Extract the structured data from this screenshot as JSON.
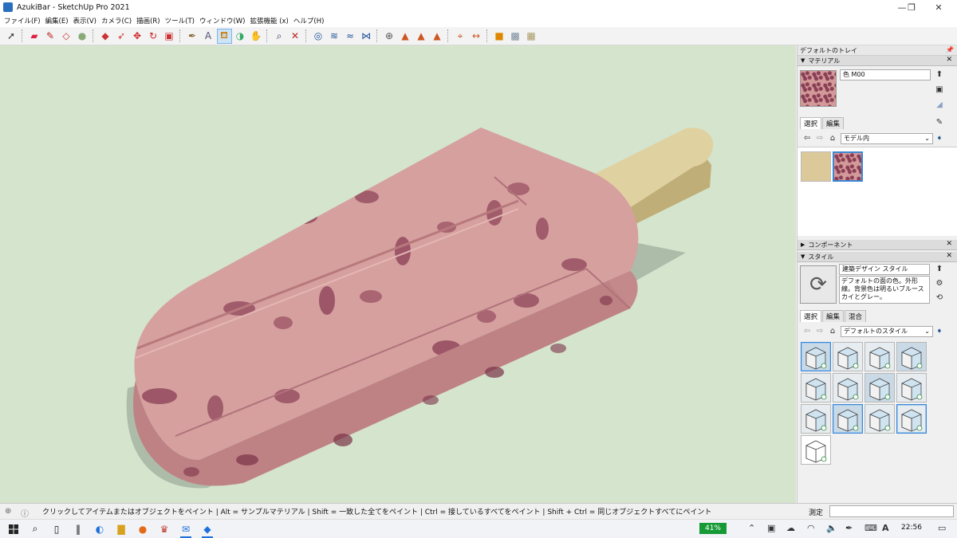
{
  "window": {
    "title": "AzukiBar - SketchUp Pro 2021",
    "minimize": "—",
    "maximize": "❐",
    "close": "✕"
  },
  "menu": [
    "ファイル(F)",
    "編集(E)",
    "表示(V)",
    "カメラ(C)",
    "描画(R)",
    "ツール(T)",
    "ウィンドウ(W)",
    "拡張機能 (x)",
    "ヘルプ(H)"
  ],
  "toolbar": {
    "tools": [
      "select-icon",
      "eraser-icon",
      "pencil-icon",
      "shape-icon",
      "circle-icon",
      "push-pull-icon",
      "follow-me-icon",
      "move-icon",
      "rotate-icon",
      "scale-icon",
      "tape-measure-icon",
      "text-icon",
      "paint-bucket-icon",
      "orbit-icon",
      "pan-icon",
      "zoom-icon",
      "zoom-extents-icon",
      "section-plane-icon",
      "section-fill-icon",
      "section-display-icon",
      "walk-icon",
      "geo-location-icon",
      "sandbox-icon",
      "sandbox-stamp-icon",
      "sandbox-drape-icon",
      "axes-icon",
      "dimension-icon",
      "warehouse-icon",
      "extension-warehouse-icon",
      "layout-icon"
    ],
    "active": "paint-bucket-icon"
  },
  "tray": {
    "title": "デフォルトのトレイ",
    "materials": {
      "header": "マテリアル",
      "material_name": "色 M00",
      "tabs": [
        "選択",
        "編集"
      ],
      "collection": "モデル内",
      "swatches": [
        {
          "name": "stick-material",
          "color": "#dcc99a"
        },
        {
          "name": "azuki-material",
          "color": "#d39a9a"
        }
      ]
    },
    "components": {
      "header": "コンポーネント"
    },
    "styles": {
      "header": "スタイル",
      "style_name": "建築デザイン スタイル",
      "description": "デフォルトの面の色。外形線。背景色は明るいブルースカイとグレー。",
      "tabs": [
        "選択",
        "編集",
        "混合"
      ],
      "collection": "デフォルトのスタイル",
      "thumb_count": 13
    }
  },
  "status": {
    "hint": "クリックしてアイテムまたはオブジェクトをペイント | Alt = サンプルマテリアル | Shift = 一致した全てをペイント | Ctrl = 接しているすべてをペイント | Shift + Ctrl = 同じオブジェクトすべてにペイント",
    "measurement_label": "測定"
  },
  "taskbar": {
    "battery": "41%",
    "time": "22:56"
  },
  "colors": {
    "viewport_bg": "#d4e4cd",
    "bar_pink": "#d6a09f",
    "bar_side": "#be8284",
    "bean": "#8a3e55",
    "stick": "#e0d1a0",
    "accent": "#3d86d4"
  }
}
